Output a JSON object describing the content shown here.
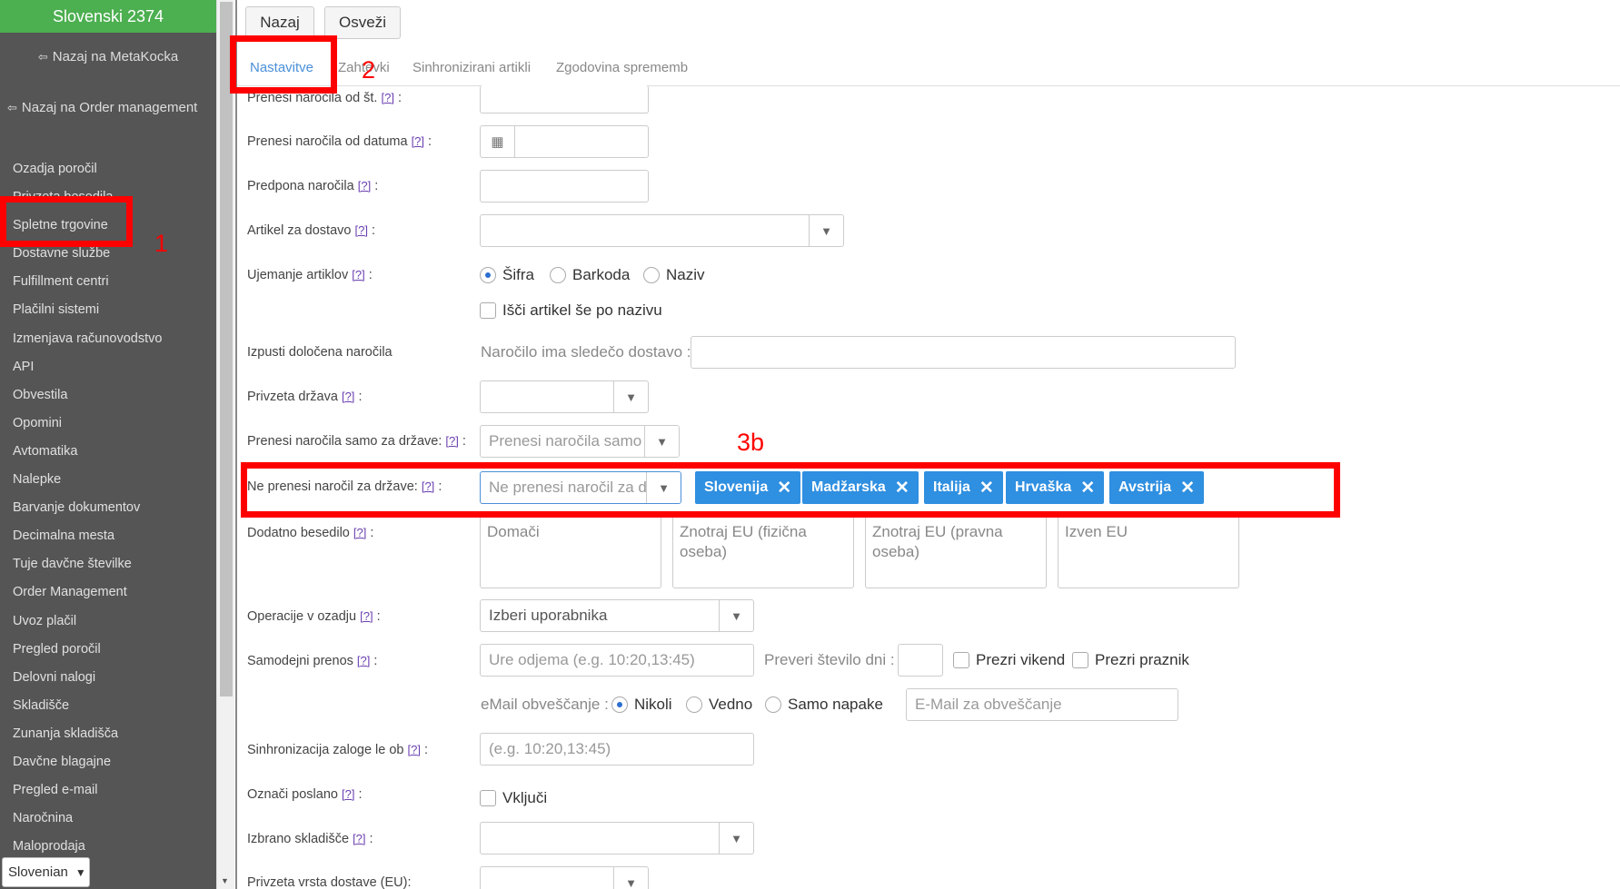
{
  "sidebar": {
    "title": "Slovenski 2374",
    "back_metakocka": "Nazaj na MetaKocka",
    "back_order_management": "Nazaj na Order management",
    "items": [
      "Ozadja poročil",
      "Privzeta besedila",
      "Spletne trgovine",
      "Dostavne službe",
      "Fulfillment centri",
      "Plačilni sistemi",
      "Izmenjava računovodstvo",
      "API",
      "Obvestila",
      "Opomini",
      "Avtomatika",
      "Nalepke",
      "Barvanje dokumentov",
      "Decimalna mesta",
      "Tuje davčne številke",
      "Order Management",
      "Uvoz plačil",
      "Pregled poročil",
      "Delovni nalogi",
      "Skladišče",
      "Zunanja skladišča",
      "Davčne blagajne",
      "Pregled e-mail",
      "Naročnina",
      "Maloprodaja"
    ],
    "language": "Slovenian"
  },
  "toolbar": {
    "back": "Nazaj",
    "refresh": "Osveži"
  },
  "tabs": [
    "Nastavitve",
    "Zahtevki",
    "Sinhronizirani artikli",
    "Zgodovina sprememb"
  ],
  "help": "[?]",
  "form": {
    "orders_from_number": {
      "label": "Prenesi naročila od št.",
      "value": ""
    },
    "orders_from_date": {
      "label": "Prenesi naročila od datuma",
      "value": ""
    },
    "order_prefix": {
      "label": "Predpona naročila",
      "value": ""
    },
    "delivery_item": {
      "label": "Artikel za dostavo",
      "value": ""
    },
    "item_matching": {
      "label": "Ujemanje artiklov",
      "options": [
        "Šifra",
        "Barkoda",
        "Naziv"
      ],
      "selected": "Šifra"
    },
    "search_by_name": {
      "label": "Išči artikel še po nazivu",
      "checked": false
    },
    "skip_orders": {
      "label": "Izpusti določena naročila",
      "sublabel": "Naročilo ima sledečo dostavo :",
      "value": ""
    },
    "default_country": {
      "label": "Privzeta država",
      "value": ""
    },
    "only_countries": {
      "label": "Prenesi naročila samo za države:",
      "placeholder": "Prenesi naročila samo za"
    },
    "exclude_countries": {
      "label": "Ne prenesi naročil za države:",
      "placeholder": "Ne prenesi naročil za d",
      "tags": [
        "Slovenija",
        "Madžarska",
        "Italija",
        "Hrvaška",
        "Avstrija"
      ]
    },
    "extra_text": {
      "label": "Dodatno besedilo",
      "fields": [
        "Domači",
        "Znotraj EU (fizična oseba)",
        "Znotraj EU (pravna oseba)",
        "Izven EU"
      ]
    },
    "background_ops": {
      "label": "Operacije v ozadju",
      "value": "Izberi uporabnika"
    },
    "auto_transfer": {
      "label": "Samodejni prenos",
      "placeholder": "Ure odjema (e.g. 10:20,13:45)",
      "check_days": "Preveri število dni :",
      "skip_weekend": "Prezri vikend",
      "skip_holiday": "Prezri praznik"
    },
    "email_notify": {
      "label": "eMail obveščanje :",
      "options": [
        "Nikoli",
        "Vedno",
        "Samo napake"
      ],
      "selected": "Nikoli",
      "placeholder": "E-Mail za obveščanje"
    },
    "stock_sync": {
      "label": "Sinhronizacija zaloge le ob",
      "placeholder": "(e.g. 10:20,13:45)"
    },
    "mark_sent": {
      "label": "Označi poslano",
      "check": "Vključi"
    },
    "warehouse": {
      "label": "Izbrano skladišče",
      "value": ""
    },
    "delivery_type_eu": {
      "label": "Privzeta vrsta dostave (EU):"
    }
  },
  "annotations": {
    "n1": "1",
    "n2": "2",
    "n3": "3b"
  },
  "colors": {
    "sidebar_bg": "#555555",
    "header_green": "#4caf50",
    "tag_blue": "#2f8fe0",
    "annotation_red": "#ff0000",
    "tab_active": "#4a90d9"
  }
}
